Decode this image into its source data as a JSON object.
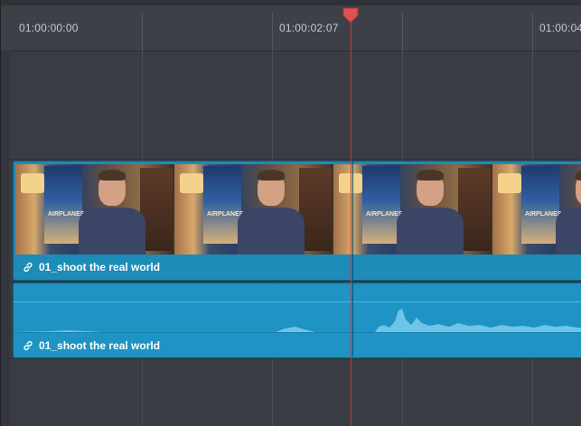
{
  "ruler": {
    "timecodes": [
      "01:00:00:00",
      "01:00:02:07",
      "01:00:04"
    ]
  },
  "video_clip": {
    "name": "01_shoot the real world",
    "poster_text": "AIRPLANES"
  },
  "audio_clip": {
    "name": "01_shoot the real world"
  },
  "colors": {
    "clip": "#1d8cb8",
    "playhead": "#e05252",
    "timeline_bg": "#393c43"
  },
  "icons": {
    "link": "link-icon",
    "playhead": "playhead-marker-icon"
  }
}
